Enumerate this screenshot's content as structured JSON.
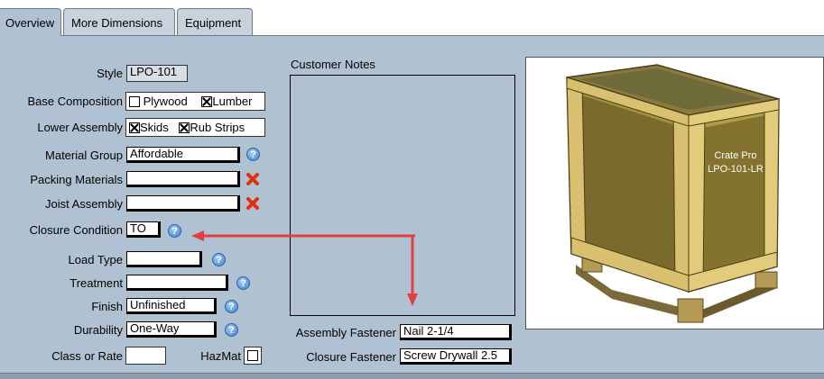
{
  "tabs": [
    {
      "label": "Overview",
      "active": true
    },
    {
      "label": "More Dimensions",
      "active": false
    },
    {
      "label": "Equipment",
      "active": false
    }
  ],
  "form": {
    "style": {
      "label": "Style",
      "value": "LPO-101"
    },
    "base_composition": {
      "label": "Base Composition",
      "plywood": "Plywood",
      "plywood_checked": false,
      "lumber": "Lumber",
      "lumber_checked": true
    },
    "lower_assembly": {
      "label": "Lower Assembly",
      "skids": "Skids",
      "skids_checked": true,
      "rub_strips": "Rub Strips",
      "rub_strips_checked": true
    },
    "material_group": {
      "label": "Material Group",
      "value": "Affordable"
    },
    "packing_materials": {
      "label": "Packing Materials",
      "value": ""
    },
    "joist_assembly": {
      "label": "Joist Assembly",
      "value": ""
    },
    "closure_condition": {
      "label": "Closure Condition",
      "value": "TO"
    },
    "load_type": {
      "label": "Load Type",
      "value": ""
    },
    "treatment": {
      "label": "Treatment",
      "value": ""
    },
    "finish": {
      "label": "Finish",
      "value": "Unfinished"
    },
    "durability": {
      "label": "Durability",
      "value": "One-Way"
    },
    "class_or_rate": {
      "label": "Class or Rate",
      "value": ""
    },
    "hazmat": {
      "label": "HazMat",
      "checked": false
    }
  },
  "notes": {
    "label": "Customer Notes",
    "value": ""
  },
  "fasteners": {
    "assembly": {
      "label": "Assembly Fastener",
      "value": "Nail 2-1/4"
    },
    "closure": {
      "label": "Closure Fastener",
      "value": "Screw Drywall 2.5"
    }
  },
  "preview": {
    "line1": "Crate Pro",
    "line2": "LPO-101-LR"
  },
  "icons": {
    "help": "help-icon",
    "error": "error-x-icon"
  },
  "colors": {
    "panel": "#b0c2d2",
    "arrow": "#e04040",
    "help_blue": "#3b7fd0",
    "error_red": "#e03010"
  }
}
